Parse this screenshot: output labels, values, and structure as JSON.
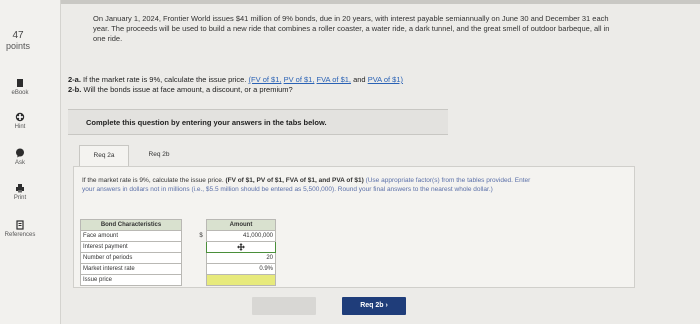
{
  "points": {
    "value": "47",
    "label": "points"
  },
  "sidebar": {
    "items": [
      {
        "label": "eBook",
        "icon": "book-icon"
      },
      {
        "label": "Hint",
        "icon": "hint-icon"
      },
      {
        "label": "Ask",
        "icon": "ask-icon"
      },
      {
        "label": "Print",
        "icon": "print-icon"
      },
      {
        "label": "References",
        "icon": "references-icon"
      }
    ]
  },
  "problem_text": "On January 1, 2024, Frontier World issues $41 million of 9% bonds, due in 20 years, with interest payable semiannually on June 30 and December 31 each year. The proceeds will be used to build a new ride that combines a roller coaster, a water ride, a dark tunnel, and the great smell of outdoor barbeque, all in one ride.",
  "part_a": {
    "label": "2-a.",
    "text": "If the market rate is 9%, calculate the issue price.",
    "links": [
      "(FV of $1,",
      "PV of $1,",
      "FVA of $1,",
      "and",
      "PVA of $1)"
    ]
  },
  "part_b": {
    "label": "2-b.",
    "text": "Will the bonds issue at face amount, a discount, or a premium?"
  },
  "instruction": "Complete this question by entering your answers in the tabs below.",
  "tabs": [
    {
      "label": "Req 2a",
      "active": true
    },
    {
      "label": "Req 2b",
      "active": false
    }
  ],
  "panel": {
    "question": "If the market rate is 9%, calculate the issue price.",
    "question_refs": "(FV of $1, PV of $1, FVA of $1, and PVA of $1)",
    "note": "(Use appropriate factor(s) from the tables provided. Enter your answers in dollars not in millions (i.e., $5.5 million should be entered as 5,500,000). Round your final answers to the nearest whole dollar.)"
  },
  "table": {
    "headers": [
      "Bond Characteristics",
      "Amount"
    ],
    "rows": [
      {
        "label": "Face amount",
        "currency": "$",
        "amount": "41,000,000"
      },
      {
        "label": "Interest payment",
        "currency": "",
        "amount": ""
      },
      {
        "label": "Number of periods",
        "currency": "",
        "amount": "20"
      },
      {
        "label": "Market interest rate",
        "currency": "",
        "amount": "0.9%"
      },
      {
        "label": "Issue price",
        "currency": "",
        "amount": ""
      }
    ]
  },
  "nav": {
    "next_label": "Req 2b  ›"
  },
  "colors": {
    "header_bg": "#d9e1cf",
    "issue_price_bg": "#e7ea7c",
    "next_btn": "#1f3d7a"
  }
}
